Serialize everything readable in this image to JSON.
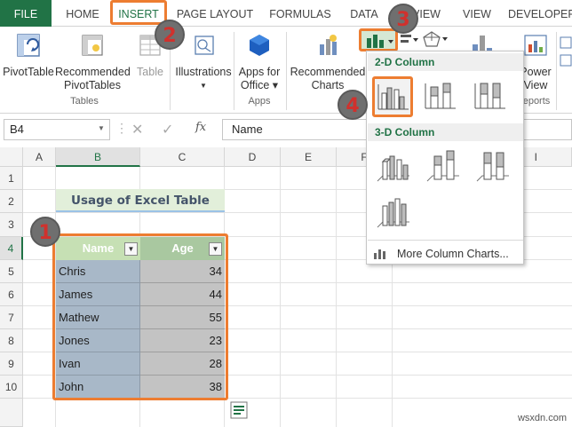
{
  "tabs": {
    "file": "FILE",
    "home": "HOME",
    "insert": "INSERT",
    "page_layout": "PAGE LAYOUT",
    "formulas": "FORMULAS",
    "data": "DATA",
    "review": "VIEW",
    "view": "VIEW",
    "developer": "DEVELOPER"
  },
  "ribbon": {
    "pivot_table": "PivotTable",
    "recommended_pivot_1": "Recommended",
    "recommended_pivot_2": "PivotTables",
    "table": "Table",
    "tables_group": "Tables",
    "illustrations": "Illustrations",
    "apps_office_1": "Apps for",
    "apps_office_2": "Office",
    "apps_group": "Apps",
    "recommended_charts_1": "Recommended",
    "recommended_charts_2": "Charts",
    "power_view_1": "Power",
    "power_view_2": "View",
    "reports_group": "eports"
  },
  "formula_bar": {
    "name_box": "B4",
    "fx": "fx",
    "content": "Name"
  },
  "grid": {
    "columns": [
      "A",
      "B",
      "C",
      "D",
      "E",
      "F",
      "I"
    ],
    "rows": [
      "1",
      "2",
      "3",
      "4",
      "5",
      "6",
      "7",
      "8",
      "9",
      "10"
    ]
  },
  "sheet": {
    "title": "Usage of Excel Table",
    "header_name": "Name",
    "header_age": "Age",
    "rows": [
      {
        "name": "Chris",
        "age": "34"
      },
      {
        "name": "James",
        "age": "44"
      },
      {
        "name": "Mathew",
        "age": "55"
      },
      {
        "name": "Jones",
        "age": "23"
      },
      {
        "name": "Ivan",
        "age": "28"
      },
      {
        "name": "John",
        "age": "38"
      }
    ]
  },
  "dropdown": {
    "section_2d": "2-D Column",
    "section_3d": "3-D Column",
    "more": "More Column Charts..."
  },
  "badges": {
    "b1": "1",
    "b2": "2",
    "b3": "3",
    "b4": "4"
  },
  "watermark": "wsxdn.com",
  "colors": {
    "excel_green": "#217346",
    "callout_orange": "#ed7d31",
    "badge_number": "#d0312d",
    "table_name_fill": "#a8b8c8",
    "table_age_fill": "#c3c3c3"
  }
}
